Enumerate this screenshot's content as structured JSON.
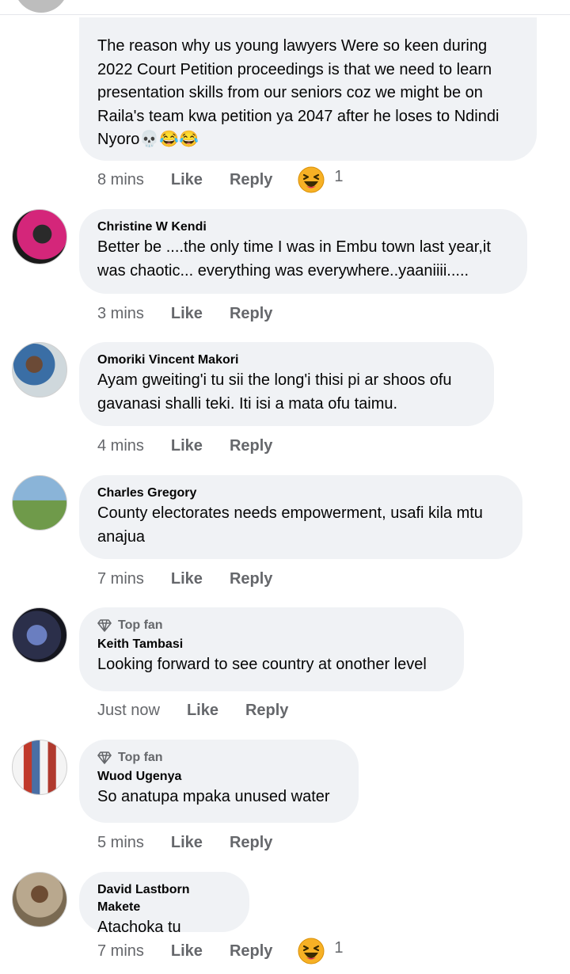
{
  "comments": [
    {
      "text": "The reason why us young lawyers Were  so keen during 2022 Court Petition  proceedings is that we need to learn presentation skills from our seniors coz we might be on Raila's team kwa petition ya 2047 after he loses to Ndindi Nyoro",
      "emoji": "💀😂😂",
      "time": "8 mins",
      "like": "Like",
      "reply": "Reply",
      "reaction_count": "1"
    },
    {
      "author": "Christine W Kendi",
      "text": "Better be ....the only time I was in Embu town last year,it was chaotic... everything was everywhere..yaaniiii.....",
      "time": "3 mins",
      "like": "Like",
      "reply": "Reply"
    },
    {
      "author": "Omoriki Vincent Makori",
      "text": "Ayam gweiting'i tu sii the long'i thisi pi ar shoos ofu gavanasi shalli teki. Iti isi a mata ofu taimu.",
      "time": "4 mins",
      "like": "Like",
      "reply": "Reply"
    },
    {
      "author": "Charles Gregory",
      "text": "County electorates needs empowerment, usafi kila mtu anajua",
      "time": "7 mins",
      "like": "Like",
      "reply": "Reply"
    },
    {
      "badge": "Top fan",
      "author": "Keith Tambasi",
      "text": "Looking forward to see country at onother level",
      "time": "Just now",
      "like": "Like",
      "reply": "Reply"
    },
    {
      "badge": "Top fan",
      "author": "Wuod Ugenya",
      "text": "So anatupa mpaka unused water",
      "time": "5 mins",
      "like": "Like",
      "reply": "Reply"
    },
    {
      "author": "David Lastborn Makete",
      "text": "Atachoka tu",
      "time": "7 mins",
      "like": "Like",
      "reply": "Reply",
      "reaction_count": "1"
    }
  ],
  "colors": {
    "bubble": "#f0f2f5",
    "meta_text": "#65676b",
    "reaction_yellow": "#f7b125"
  },
  "icons": {
    "reaction": "laughing-face-icon",
    "top_fan": "diamond-icon"
  }
}
